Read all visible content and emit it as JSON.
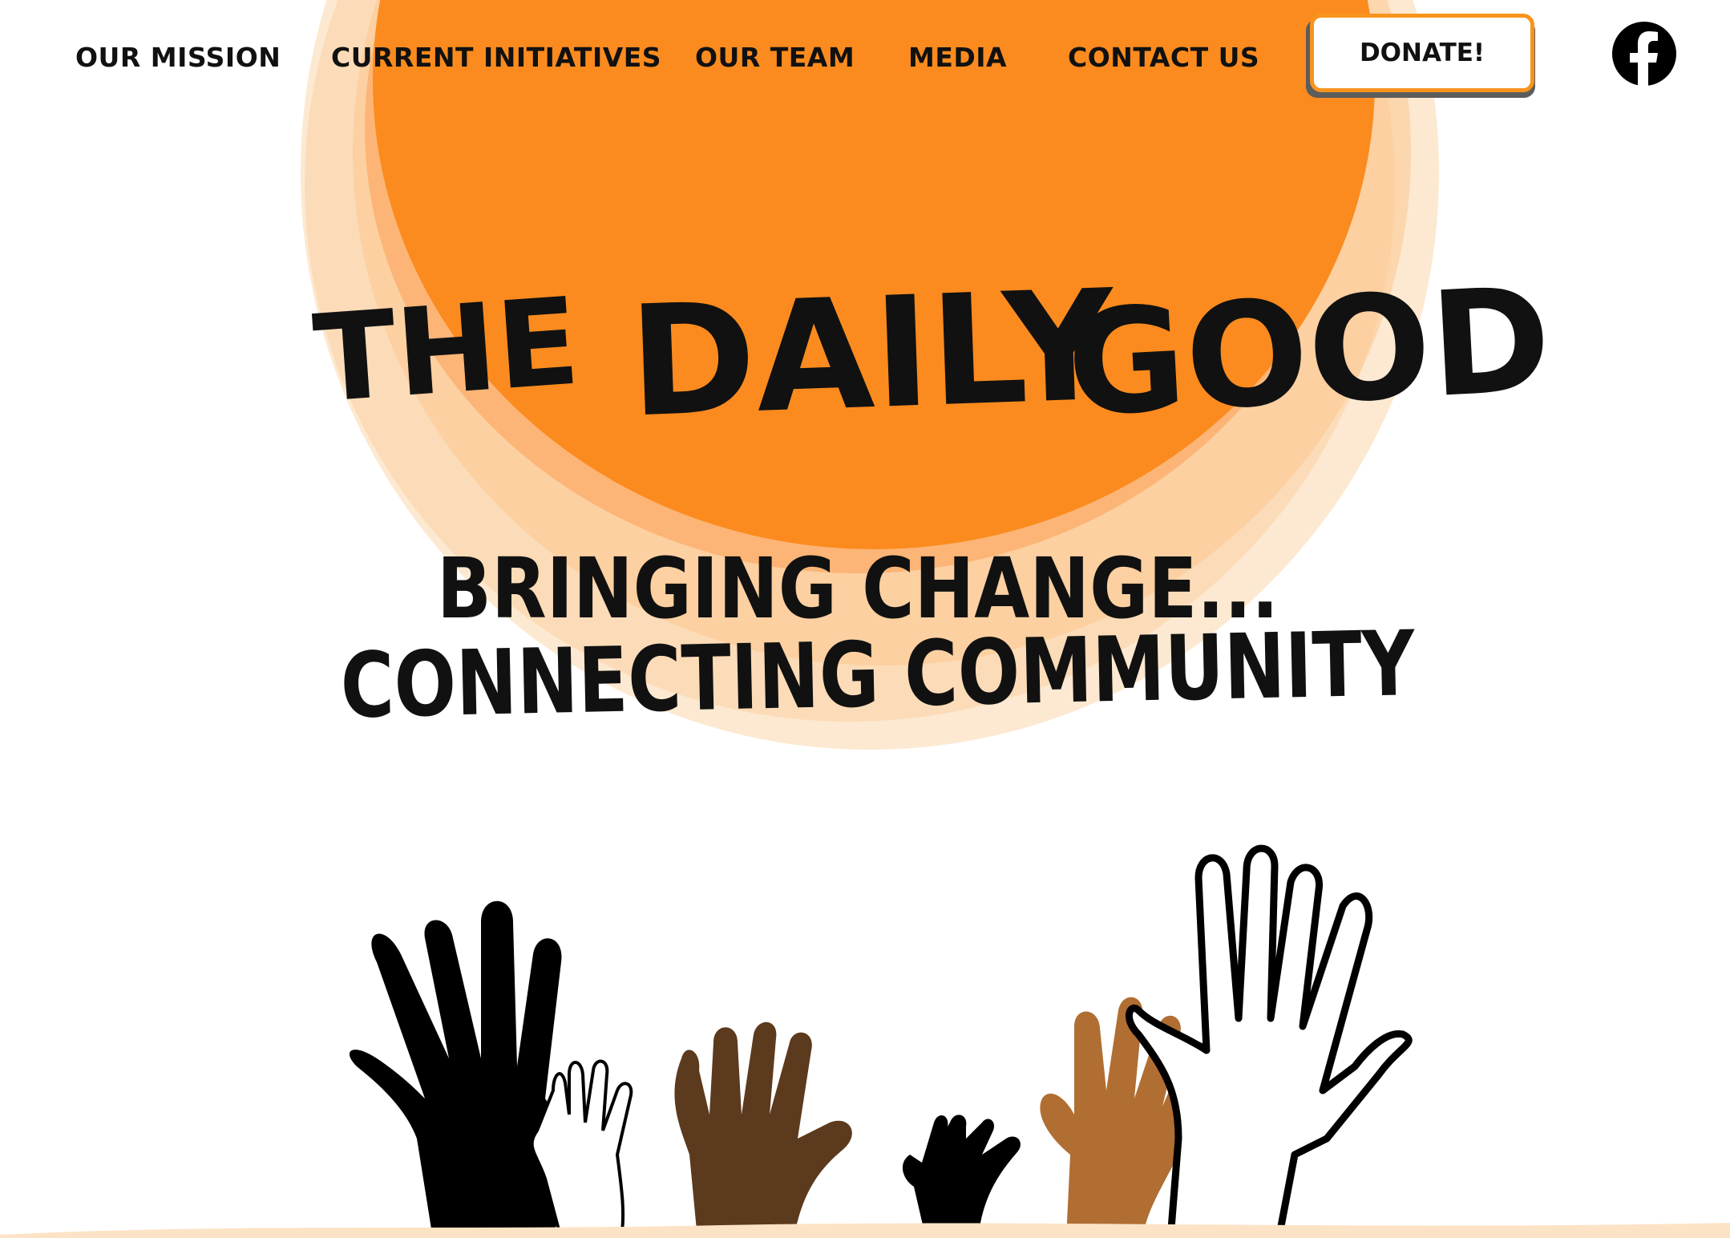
{
  "nav": {
    "items": [
      {
        "label": "OUR MISSION"
      },
      {
        "label": "CURRENT INITIATIVES"
      },
      {
        "label": "OUR TEAM"
      },
      {
        "label": "MEDIA"
      },
      {
        "label": "CONTACT US"
      }
    ],
    "donate_label": "DONATE!",
    "social_icon": "facebook-icon"
  },
  "hero": {
    "logo_words": [
      "THE",
      "DAILY",
      "GOOD"
    ],
    "tagline_line1": "BRINGING CHANGE...",
    "tagline_line2": "CONNECTING COMMUNITY",
    "sun_icon": "sun-illustration",
    "hands_icon": "raised-hands-illustration"
  },
  "colors": {
    "accent_orange": "#f7941d",
    "sun_orange": "#fb8b1e",
    "sun_glow": "#fcd3a6",
    "text": "#111111",
    "hand_black": "#000000",
    "hand_dark_brown": "#5c3a1e",
    "hand_tan": "#b06e33",
    "hand_white": "#ffffff"
  }
}
